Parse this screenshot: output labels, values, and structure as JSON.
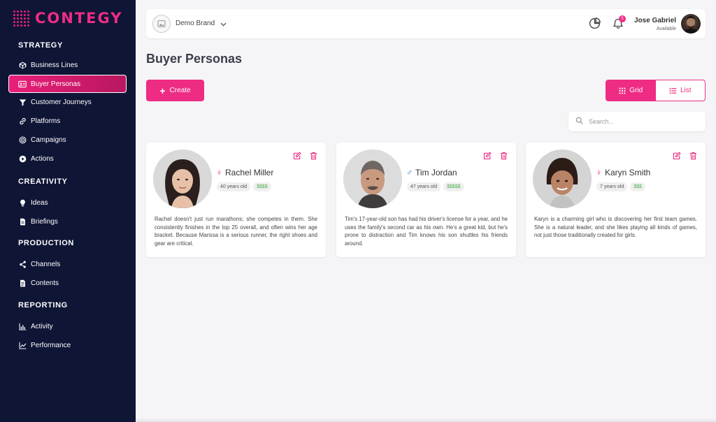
{
  "app": {
    "logo_text": "CONTEGY",
    "accent_color": "#ee2c84",
    "sidebar_color": "#0f1535"
  },
  "sidebar": {
    "sections": [
      {
        "header": "STRATEGY",
        "items": [
          {
            "label": "Business Lines",
            "icon": "box-icon"
          },
          {
            "label": "Buyer Personas",
            "icon": "id-card-icon",
            "active": true
          },
          {
            "label": "Customer Journeys",
            "icon": "filter-icon"
          },
          {
            "label": "Platforms",
            "icon": "link-icon"
          },
          {
            "label": "Campaigns",
            "icon": "target-icon"
          },
          {
            "label": "Actions",
            "icon": "play-icon"
          }
        ]
      },
      {
        "header": "CREATIVITY",
        "items": [
          {
            "label": "Ideas",
            "icon": "lightbulb-icon"
          },
          {
            "label": "Briefings",
            "icon": "document-icon"
          }
        ]
      },
      {
        "header": "PRODUCTION",
        "items": [
          {
            "label": "Channels",
            "icon": "share-icon"
          },
          {
            "label": "Contents",
            "icon": "file-icon"
          }
        ]
      },
      {
        "header": "REPORTING",
        "items": [
          {
            "label": "Activity",
            "icon": "bar-chart-icon"
          },
          {
            "label": "Performance",
            "icon": "line-chart-icon"
          }
        ]
      }
    ]
  },
  "topbar": {
    "brand_name": "Demo Brand",
    "notification_count": "5",
    "user_name": "Jose Gabriel",
    "user_status": "Available"
  },
  "page": {
    "title": "Buyer Personas",
    "create_label": "Create",
    "view_grid_label": "Grid",
    "view_list_label": "List",
    "search_placeholder": "Search..."
  },
  "personas": [
    {
      "name": "Rachel Miller",
      "gender": "female",
      "gender_symbol": "♀",
      "gender_color": "#e91e7a",
      "age": "40 years old",
      "budget": "$$$$",
      "description": "Rachel doesn't just run marathons; she competes in them. She consistently finishes in the top 25 overall, and often wins her age bracket. Because Marissa is a serious runner, the right shoes and gear are critical."
    },
    {
      "name": "Tim Jordan",
      "gender": "male",
      "gender_symbol": "♂",
      "gender_color": "#2f6fd6",
      "age": "47 years old",
      "budget": "$$$$$",
      "description": "Tim's 17-year-old son has had his driver's license for a year, and he uses the family's second car as his own. He's a great kid, but he's prone to distraction and Tim knows his son shuttles his friends around."
    },
    {
      "name": "Karyn Smith",
      "gender": "female",
      "gender_symbol": "♀",
      "gender_color": "#e91e7a",
      "age": "7 years old",
      "budget": "$$$",
      "description": "Karyn is a charming girl who is discovering her first team games. She is a natural leader, and she likes playing all kinds of games, not just those traditionally created for girls."
    }
  ]
}
